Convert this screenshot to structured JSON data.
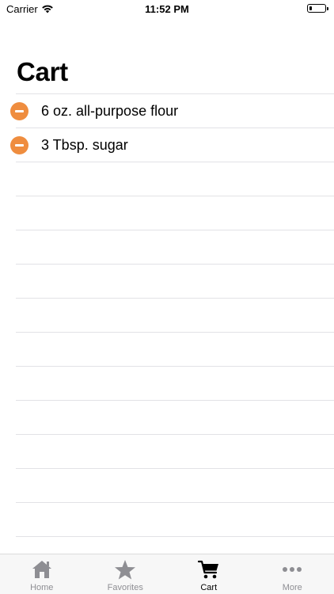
{
  "status_bar": {
    "carrier": "Carrier",
    "time": "11:52 PM"
  },
  "page": {
    "title": "Cart"
  },
  "cart": {
    "items": [
      {
        "label": "6 oz. all-purpose flour"
      },
      {
        "label": "3 Tbsp. sugar"
      }
    ]
  },
  "tab_bar": {
    "tabs": [
      {
        "label": "Home",
        "icon": "home-icon",
        "active": false
      },
      {
        "label": "Favorites",
        "icon": "star-icon",
        "active": false
      },
      {
        "label": "Cart",
        "icon": "cart-icon",
        "active": true
      },
      {
        "label": "More",
        "icon": "more-icon",
        "active": false
      }
    ]
  },
  "colors": {
    "delete_accent": "#ef8d3f",
    "inactive_tab": "#8e8e93",
    "active_tab": "#000000"
  }
}
